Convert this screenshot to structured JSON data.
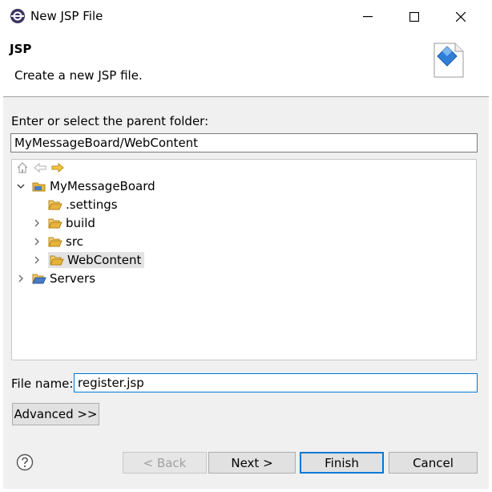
{
  "window": {
    "title": "New JSP File",
    "controls": {
      "minimize": "minimize-icon",
      "maximize": "maximize-icon",
      "close": "close-icon"
    }
  },
  "header": {
    "title": "JSP",
    "description": "Create a new JSP file."
  },
  "folder": {
    "label": "Enter or select the parent folder:",
    "value": "MyMessageBoard/WebContent"
  },
  "tree": {
    "nav_icons": [
      "home-icon",
      "back-arrow-icon",
      "forward-arrow-icon"
    ],
    "items": [
      {
        "label": "MyMessageBoard",
        "expanded": true,
        "selected": false
      },
      {
        "label": ".settings",
        "expanded": false,
        "selected": false
      },
      {
        "label": "build",
        "expanded": false,
        "selected": false
      },
      {
        "label": "src",
        "expanded": false,
        "selected": false
      },
      {
        "label": "WebContent",
        "expanded": false,
        "selected": true
      },
      {
        "label": "Servers",
        "expanded": false,
        "selected": false
      }
    ]
  },
  "file": {
    "label": "File name:",
    "value": "register.jsp"
  },
  "buttons": {
    "advanced": "Advanced >>",
    "back": "< Back",
    "next": "Next >",
    "finish": "Finish",
    "cancel": "Cancel"
  },
  "colors": {
    "accent": "#0078d7",
    "folder": "#e8b33c",
    "button_bg": "#e1e1e1",
    "dialog_bg": "#f0f0f0"
  }
}
